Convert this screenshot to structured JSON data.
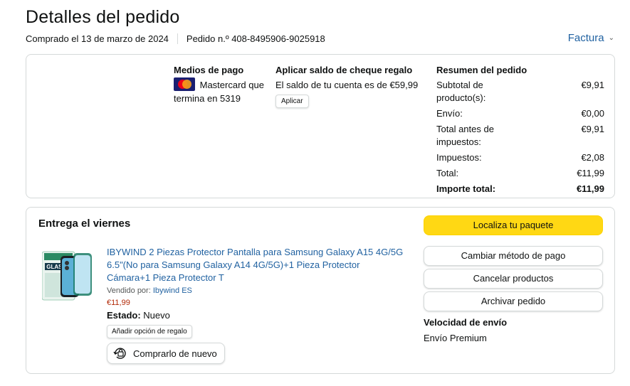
{
  "header": {
    "title": "Detalles del pedido",
    "purchased": "Comprado el 13 de marzo de 2024",
    "order": "Pedido n.º 408-8495906-9025918",
    "invoice": "Factura"
  },
  "payment": {
    "title": "Medios de pago",
    "card_text_1": "Mastercard que",
    "card_text_2": "termina en 5319",
    "card_icon": "mastercard-icon"
  },
  "gift_card": {
    "title": "Aplicar saldo de cheque regalo",
    "balance": "El saldo de tu cuenta es de €59,99",
    "apply": "Aplicar"
  },
  "summary": {
    "title": "Resumen del pedido",
    "rows": [
      {
        "label": "Subtotal de producto(s):",
        "value": "€9,91"
      },
      {
        "label": "Envío:",
        "value": "€0,00"
      },
      {
        "label": "Total antes de impuestos:",
        "value": "€9,91"
      },
      {
        "label": "Impuestos:",
        "value": "€2,08"
      },
      {
        "label": "Total:",
        "value": "€11,99"
      },
      {
        "label": "Importe total:",
        "value": "€11,99"
      }
    ]
  },
  "delivery": {
    "title": "Entrega el viernes",
    "product": {
      "title": "IBYWIND 2 Piezas Protector Pantalla para Samsung Galaxy A15 4G/5G 6.5\"(No para Samsung Galaxy A14 4G/5G)+1 Pieza Protector Cámara+1 Pieza Protector T",
      "sold_by_label": "Vendido por:",
      "seller": "Ibywind ES",
      "price": "€11,99",
      "status_label": "Estado:",
      "status_value": "Nuevo",
      "gift_option": "Añadir opción de regalo",
      "rebuy": "Comprarlo de nuevo",
      "thumb_text": "GLASS"
    },
    "actions": {
      "track": "Localiza tu paquete",
      "change_payment": "Cambiar método de pago",
      "cancel": "Cancelar productos",
      "archive": "Archivar pedido"
    },
    "shipping_speed_title": "Velocidad de envío",
    "shipping_speed": "Envío Premium"
  },
  "colors": {
    "link": "#2162a1",
    "primary_button": "#ffd814",
    "price": "#b12704",
    "border": "#d5d9d9"
  }
}
